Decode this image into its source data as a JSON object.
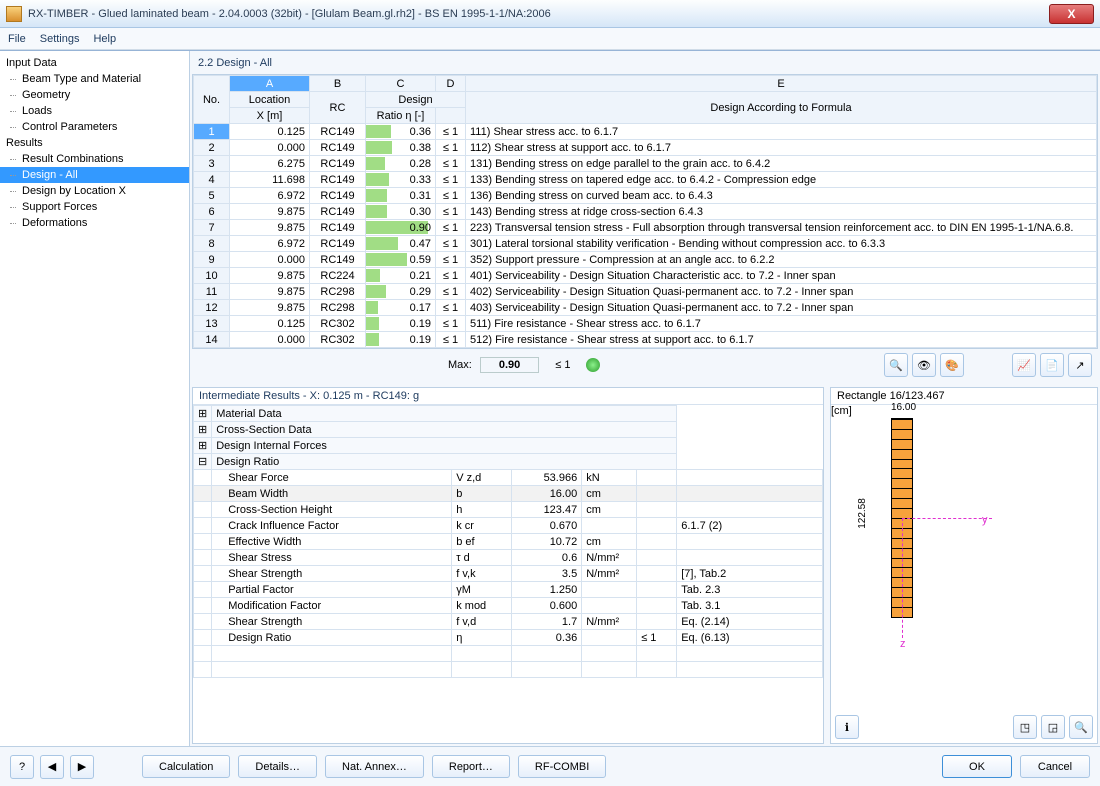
{
  "window": {
    "title": "RX-TIMBER - Glued laminated beam - 2.04.0003 (32bit) - [Glulam Beam.gl.rh2] - BS EN 1995-1-1/NA:2006",
    "close": "X"
  },
  "menu": {
    "file": "File",
    "settings": "Settings",
    "help": "Help"
  },
  "tree": {
    "input": "Input Data",
    "input_items": [
      "Beam Type and Material",
      "Geometry",
      "Loads",
      "Control Parameters"
    ],
    "results": "Results",
    "result_items": [
      "Result Combinations",
      "Design - All",
      "Design by Location X",
      "Support Forces",
      "Deformations"
    ],
    "selected": "Design - All"
  },
  "pane_title": "2.2 Design - All",
  "table": {
    "colletters": [
      "A",
      "B",
      "C",
      "D",
      "E"
    ],
    "h_no": "No.",
    "h_location": "Location",
    "h_x": "X [m]",
    "h_rc": "RC",
    "h_design": "Design",
    "h_ratio": "Ratio η [-]",
    "h_formula": "Design According to Formula",
    "rows": [
      {
        "no": "1",
        "x": "0.125",
        "rc": "RC149",
        "ratio": "0.36",
        "cond": "≤ 1",
        "formula": "111) Shear stress acc. to 6.1.7"
      },
      {
        "no": "2",
        "x": "0.000",
        "rc": "RC149",
        "ratio": "0.38",
        "cond": "≤ 1",
        "formula": "112) Shear stress at support acc. to 6.1.7"
      },
      {
        "no": "3",
        "x": "6.275",
        "rc": "RC149",
        "ratio": "0.28",
        "cond": "≤ 1",
        "formula": "131) Bending stress on edge parallel to the grain acc. to 6.4.2"
      },
      {
        "no": "4",
        "x": "11.698",
        "rc": "RC149",
        "ratio": "0.33",
        "cond": "≤ 1",
        "formula": "133) Bending stress on tapered edge acc. to 6.4.2 - Compression edge"
      },
      {
        "no": "5",
        "x": "6.972",
        "rc": "RC149",
        "ratio": "0.31",
        "cond": "≤ 1",
        "formula": "136) Bending stress on curved beam acc. to 6.4.3"
      },
      {
        "no": "6",
        "x": "9.875",
        "rc": "RC149",
        "ratio": "0.30",
        "cond": "≤ 1",
        "formula": "143) Bending stress at ridge cross-section 6.4.3"
      },
      {
        "no": "7",
        "x": "9.875",
        "rc": "RC149",
        "ratio": "0.90",
        "cond": "≤ 1",
        "formula": "223) Transversal tension stress - Full absorption through transversal tension reinforcement acc. to DIN EN 1995-1-1/NA.6.8."
      },
      {
        "no": "8",
        "x": "6.972",
        "rc": "RC149",
        "ratio": "0.47",
        "cond": "≤ 1",
        "formula": "301) Lateral torsional stability verification - Bending without compression acc. to 6.3.3"
      },
      {
        "no": "9",
        "x": "0.000",
        "rc": "RC149",
        "ratio": "0.59",
        "cond": "≤ 1",
        "formula": "352) Support pressure - Compression at an angle acc. to 6.2.2"
      },
      {
        "no": "10",
        "x": "9.875",
        "rc": "RC224",
        "ratio": "0.21",
        "cond": "≤ 1",
        "formula": "401) Serviceability - Design Situation Characteristic acc. to 7.2 - Inner span"
      },
      {
        "no": "11",
        "x": "9.875",
        "rc": "RC298",
        "ratio": "0.29",
        "cond": "≤ 1",
        "formula": "402) Serviceability - Design Situation Quasi-permanent acc. to 7.2 - Inner span"
      },
      {
        "no": "12",
        "x": "9.875",
        "rc": "RC298",
        "ratio": "0.17",
        "cond": "≤ 1",
        "formula": "403) Serviceability - Design Situation Quasi-permanent acc. to 7.2 - Inner span"
      },
      {
        "no": "13",
        "x": "0.125",
        "rc": "RC302",
        "ratio": "0.19",
        "cond": "≤ 1",
        "formula": "511) Fire resistance - Shear stress acc. to 6.1.7"
      },
      {
        "no": "14",
        "x": "0.000",
        "rc": "RC302",
        "ratio": "0.19",
        "cond": "≤ 1",
        "formula": "512) Fire resistance - Shear stress at support acc. to 6.1.7"
      }
    ],
    "max_label": "Max:",
    "max_val": "0.90",
    "max_cond": "≤ 1"
  },
  "intermediate": {
    "title": "Intermediate Results  -  X: 0.125 m  -  RC149: g",
    "groups": [
      "Material Data",
      "Cross-Section Data",
      "Design Internal Forces",
      "Design Ratio"
    ],
    "rows": [
      {
        "label": "Shear Force",
        "sym": "V z,d",
        "val": "53.966",
        "unit": "kN",
        "ref": ""
      },
      {
        "label": "Beam Width",
        "sym": "b",
        "val": "16.00",
        "unit": "cm",
        "ref": "",
        "hl": true
      },
      {
        "label": "Cross-Section Height",
        "sym": "h",
        "val": "123.47",
        "unit": "cm",
        "ref": ""
      },
      {
        "label": "Crack Influence Factor",
        "sym": "k cr",
        "val": "0.670",
        "unit": "",
        "ref": "6.1.7 (2)"
      },
      {
        "label": "Effective Width",
        "sym": "b ef",
        "val": "10.72",
        "unit": "cm",
        "ref": ""
      },
      {
        "label": "Shear Stress",
        "sym": "τ d",
        "val": "0.6",
        "unit": "N/mm²",
        "ref": ""
      },
      {
        "label": "Shear Strength",
        "sym": "f v,k",
        "val": "3.5",
        "unit": "N/mm²",
        "ref": "[7], Tab.2"
      },
      {
        "label": "Partial Factor",
        "sym": "γM",
        "val": "1.250",
        "unit": "",
        "ref": "Tab. 2.3"
      },
      {
        "label": "Modification Factor",
        "sym": "k mod",
        "val": "0.600",
        "unit": "",
        "ref": "Tab. 3.1"
      },
      {
        "label": "Shear Strength",
        "sym": "f v,d",
        "val": "1.7",
        "unit": "N/mm²",
        "ref": "Eq. (2.14)"
      },
      {
        "label": "Design Ratio",
        "sym": "η",
        "val": "0.36",
        "unit": "",
        "cond": "≤ 1",
        "ref": "Eq. (6.13)"
      }
    ]
  },
  "section": {
    "title": "Rectangle 16/123.467",
    "w": "16.00",
    "h": "122.58",
    "y": "y",
    "z": "z",
    "unit": "[cm]"
  },
  "footer": {
    "calc": "Calculation",
    "details": "Details…",
    "annex": "Nat. Annex…",
    "report": "Report…",
    "combi": "RF-COMBI",
    "ok": "OK",
    "cancel": "Cancel"
  }
}
